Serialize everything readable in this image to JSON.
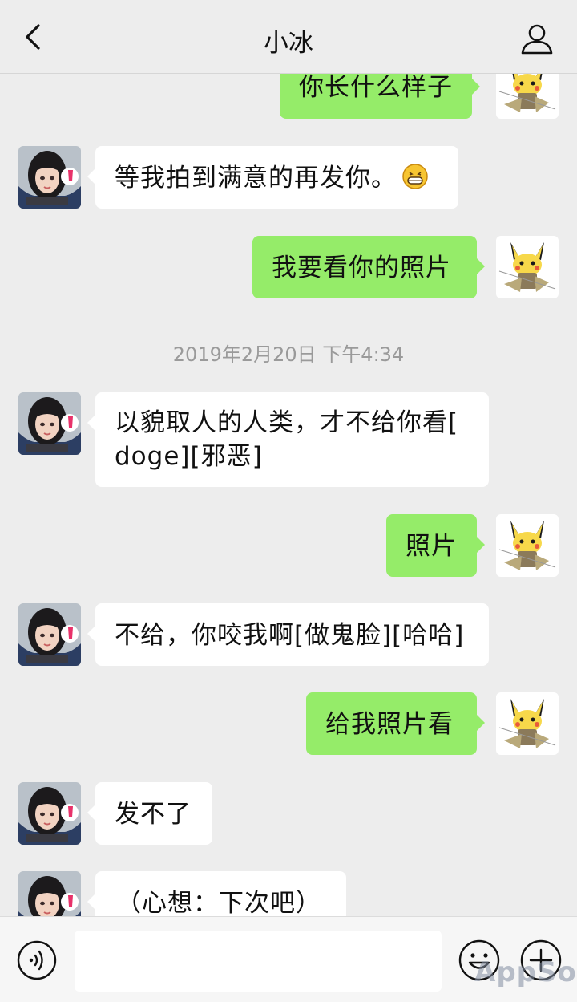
{
  "header": {
    "title": "小冰"
  },
  "timestamp": "2019年2月20日 下午4:34",
  "messages": [
    {
      "from": "me",
      "text": "你长什么样子"
    },
    {
      "from": "bot",
      "text": "等我拍到满意的再发你。",
      "emoji": "grin-emoji"
    },
    {
      "from": "me",
      "text": "我要看你的照片"
    },
    {
      "from": "bot",
      "text_line1": "以貌取人的人类，才不给你看[",
      "text_line2": "doge][邪恶]"
    },
    {
      "from": "me",
      "text": "照片"
    },
    {
      "from": "bot",
      "text": "不给，你咬我啊[做鬼脸][哈哈]"
    },
    {
      "from": "me",
      "text": "给我照片看"
    },
    {
      "from": "bot",
      "text": "发不了"
    },
    {
      "from": "bot",
      "text": "（心想：下次吧）"
    }
  ],
  "input": {
    "value": ""
  },
  "watermark": "AppSo",
  "colors": {
    "outgoing_bubble": "#95ec69",
    "incoming_bubble": "#ffffff",
    "background": "#ededed"
  },
  "icons": [
    "back-arrow-icon",
    "profile-icon",
    "voice-icon",
    "emoji-icon",
    "plus-icon"
  ]
}
